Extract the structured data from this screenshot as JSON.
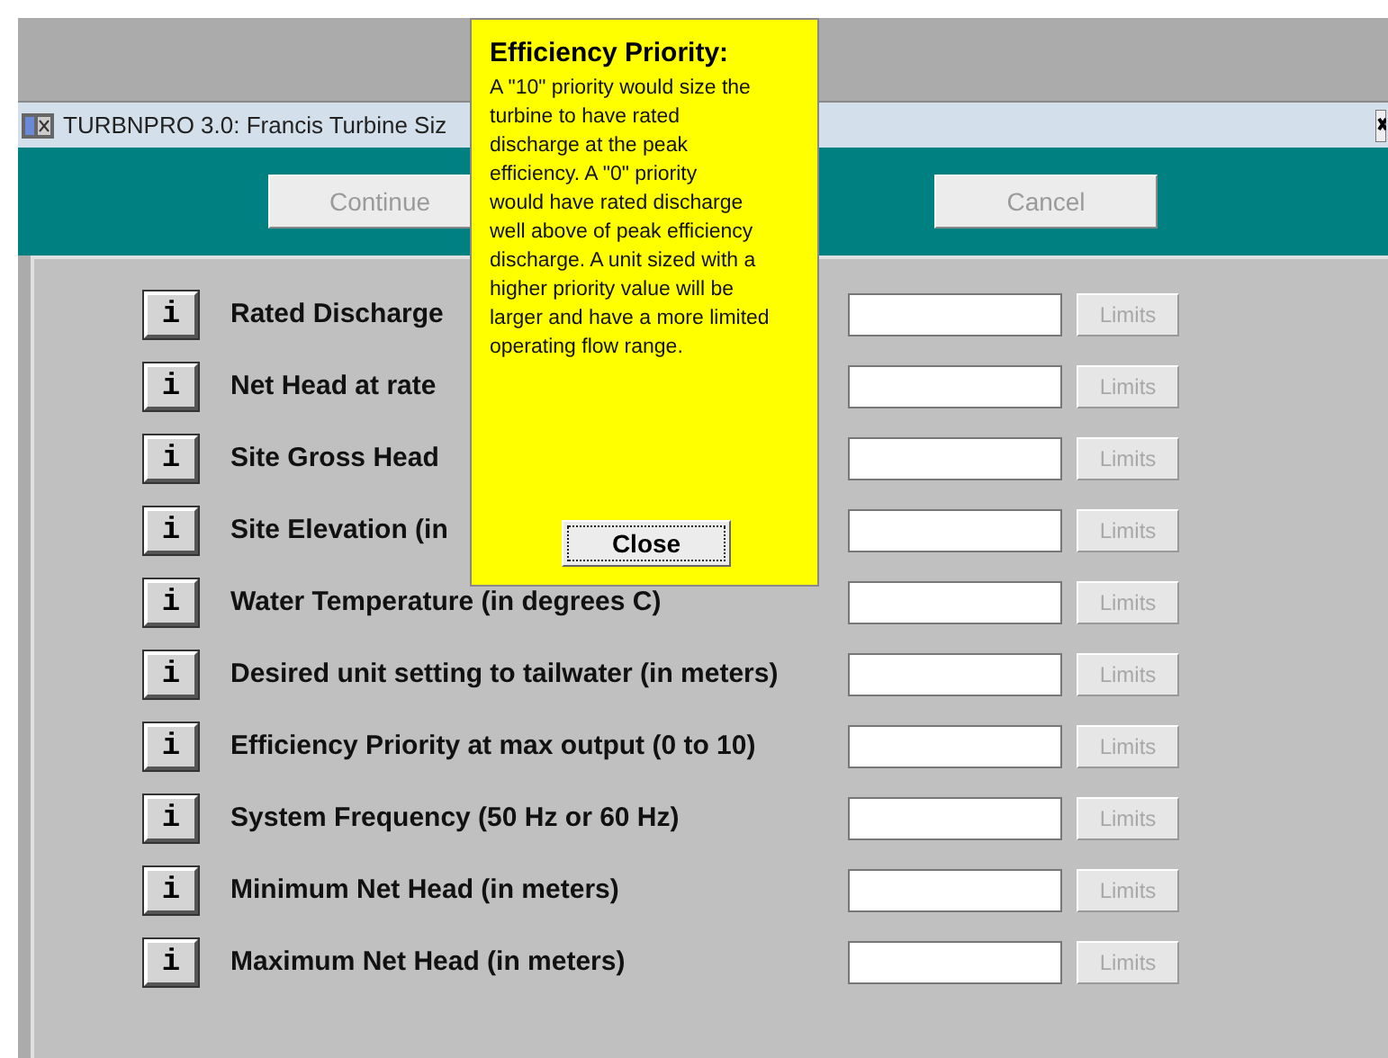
{
  "window": {
    "title": "TURBNPRO 3.0: Francis Turbine Siz"
  },
  "buttons": [
    {
      "label": "Continue",
      "disabled": true
    },
    {
      "label": "Cancel",
      "disabled": true
    }
  ],
  "fields": [
    {
      "label": "Rated Discharge",
      "info": "i",
      "limits": "Limits",
      "limits_disabled": true
    },
    {
      "label": "Net Head at rate",
      "info": "i",
      "limits": "Limits",
      "limits_disabled": true
    },
    {
      "label": "Site Gross Head",
      "info": "i",
      "limits": "Limits",
      "limits_disabled": true
    },
    {
      "label": "Site Elevation (in",
      "info": "i",
      "limits": "Limits",
      "limits_disabled": true
    },
    {
      "label": "Water Temperature (in degrees C)",
      "info": "i",
      "limits": "Limits",
      "limits_disabled": true
    },
    {
      "label": "Desired unit setting to tailwater (in meters)",
      "info": "i",
      "limits": "Limits",
      "limits_disabled": true
    },
    {
      "label": "Efficiency Priority at max output (0 to 10)",
      "info": "i",
      "limits": "Limits",
      "limits_disabled": true
    },
    {
      "label": "System Frequency (50 Hz or 60 Hz)",
      "info": "i",
      "limits": "Limits",
      "limits_disabled": true
    },
    {
      "label": "Minimum Net Head (in meters)",
      "info": "i",
      "limits": "Limits",
      "limits_disabled": true
    },
    {
      "label": "Maximum Net Head (in meters)",
      "info": "i",
      "limits": "Limits",
      "limits_disabled": true
    }
  ],
  "popup": {
    "title": "Efficiency Priority:",
    "lines": [
      "A \"10\" priority would size the",
      "turbine to have rated",
      "discharge at the peak",
      "efficiency.  A \"0\" priority",
      "would have rated discharge",
      "well above of peak efficiency",
      "discharge. A unit sized with a",
      "higher priority value will be",
      "larger and have a more limited",
      "operating flow range."
    ],
    "button": "Close"
  }
}
